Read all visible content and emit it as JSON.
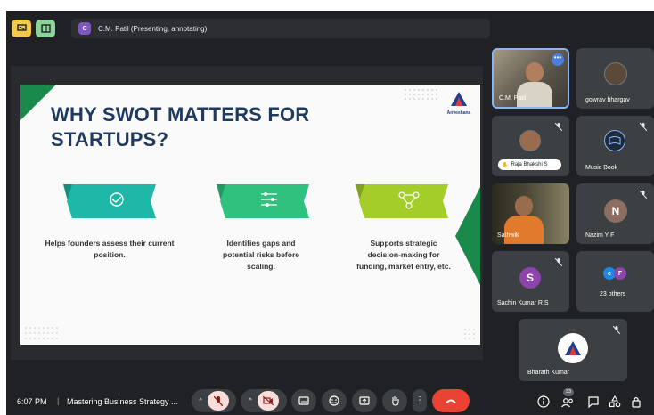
{
  "presenter_bar": {
    "avatar_letter": "C",
    "label": "C.M. Patil (Presenting, annotating)"
  },
  "slide": {
    "title_line1": "WHY SWOT MATTERS FOR",
    "title_line2": "STARTUPS?",
    "brand": "Anveshana",
    "items": [
      {
        "text": "Helps founders assess their current position.",
        "color": "#1fb7a6",
        "icon": "handshake-icon"
      },
      {
        "text": "Identifies gaps and potential risks before scaling.",
        "color": "#2ec27e",
        "icon": "sliders-icon"
      },
      {
        "text": "Supports strategic decision-making for funding, market entry, etc.",
        "color": "#a4cd2a",
        "icon": "network-icon"
      }
    ],
    "colors": {
      "title": "#1f3a5f",
      "accent_green": "#1a8a4a"
    }
  },
  "participants": [
    {
      "name": "C.M. Patil",
      "type": "video"
    },
    {
      "name": "gowrav bhargav",
      "type": "photo"
    },
    {
      "name": "Raja Bhakshi S",
      "type": "photo"
    },
    {
      "name": "Music Book",
      "type": "logo"
    },
    {
      "name": "Sathwik",
      "type": "video"
    },
    {
      "name": "Nazim Y F",
      "letter": "N",
      "color": "#8d6e63"
    },
    {
      "name": "Sachin Kumar R S",
      "letter": "S",
      "color": "#8e44ad"
    },
    {
      "name": "23 others",
      "letters": [
        "c",
        "F"
      ]
    },
    {
      "name": "Bharath Kumar",
      "type": "logo"
    }
  ],
  "bottom_bar": {
    "time": "6:07 PM",
    "separator": "|",
    "meeting_title": "Mastering Business Strategy ...",
    "people_count": "33"
  }
}
